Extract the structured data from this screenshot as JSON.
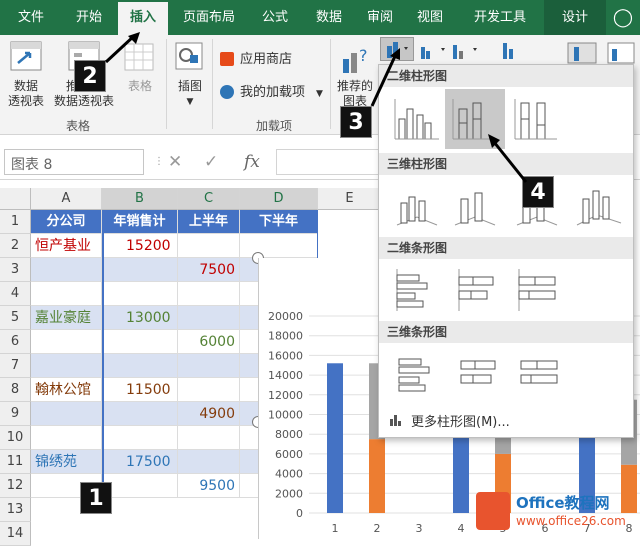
{
  "tabs": [
    "文件",
    "开始",
    "插入",
    "页面布局",
    "公式",
    "数据",
    "审阅",
    "视图",
    "开发工具",
    "设计"
  ],
  "ribbon": {
    "pivot_table": "数据\n透视表",
    "recommended_pivot": "推荐的\n数据透视表",
    "table": "表格",
    "illustrations": "插图",
    "app_store": "应用商店",
    "my_addins": "我的加载项",
    "recommended_charts": "推荐的\n图表",
    "group_tables": "表格",
    "group_addins": "加载项"
  },
  "formula_bar": {
    "name_box": "图表 8",
    "fx": "fx"
  },
  "columns": [
    "A",
    "B",
    "C",
    "D",
    "E"
  ],
  "rows": [
    "1",
    "2",
    "3",
    "4",
    "5",
    "6",
    "7",
    "8",
    "9",
    "10",
    "11",
    "12",
    "13",
    "14"
  ],
  "table": {
    "headers": [
      "分公司",
      "年销售计",
      "上半年",
      "下半年"
    ],
    "rows": [
      {
        "a": "恒产基业",
        "b": "15200",
        "c": "",
        "color": "#c00000"
      },
      {
        "a": "",
        "b": "",
        "c": "7500",
        "color": "#c00000"
      },
      {
        "a": "",
        "b": "",
        "c": "",
        "color": "#000"
      },
      {
        "a": "嘉业豪庭",
        "b": "13000",
        "c": "",
        "color": "#548235"
      },
      {
        "a": "",
        "b": "",
        "c": "6000",
        "color": "#548235"
      },
      {
        "a": "",
        "b": "",
        "c": "",
        "color": "#000"
      },
      {
        "a": "翰林公馆",
        "b": "11500",
        "c": "",
        "color": "#843c0c"
      },
      {
        "a": "",
        "b": "",
        "c": "4900",
        "color": "#843c0c"
      },
      {
        "a": "",
        "b": "",
        "c": "",
        "color": "#000"
      },
      {
        "a": "锦绣苑",
        "b": "17500",
        "c": "",
        "color": "#2e75b6"
      },
      {
        "a": "",
        "b": "",
        "c": "9500",
        "color": "#2e75b6"
      }
    ]
  },
  "dropdown": {
    "sections": [
      "二维柱形图",
      "三维柱形图",
      "二维条形图",
      "三维条形图"
    ],
    "more": "更多柱形图(M)..."
  },
  "steps": [
    "1",
    "2",
    "3",
    "4"
  ],
  "chart_data": {
    "type": "bar",
    "categories": [
      "1",
      "2",
      "3",
      "4",
      "5",
      "6",
      "7",
      "8"
    ],
    "ylim": [
      0,
      20000
    ],
    "yticks": [
      "20000",
      "18000",
      "16000",
      "14000",
      "12000",
      "10000",
      "8000",
      "6000",
      "4000",
      "2000",
      "0"
    ],
    "series": [
      {
        "values": [
          15200,
          0,
          0,
          13000,
          0,
          0,
          11500,
          0
        ],
        "color": "#4472c4"
      },
      {
        "values": [
          0,
          7500,
          0,
          0,
          6000,
          0,
          0,
          4900
        ],
        "color": "#ed7d31"
      },
      {
        "values": [
          0,
          7700,
          0,
          0,
          7000,
          0,
          0,
          6600
        ],
        "color": "#a5a5a5"
      }
    ]
  },
  "watermark": {
    "brand": "Office教程网",
    "url": "www.office26.com"
  }
}
